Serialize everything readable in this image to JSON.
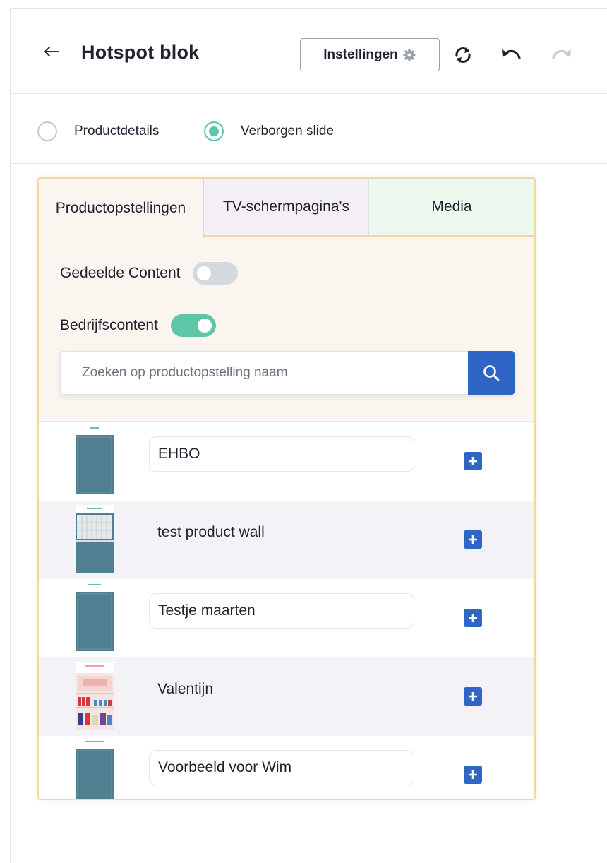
{
  "header": {
    "title": "Hotspot blok",
    "settings_label": "Instellingen"
  },
  "radios": [
    {
      "label": "Productdetails",
      "selected": false
    },
    {
      "label": "Verborgen slide",
      "selected": true
    }
  ],
  "tabs": [
    {
      "label": "Productopstellingen",
      "active": true
    },
    {
      "label": "TV-schermpagina's",
      "active": false
    },
    {
      "label": "Media",
      "active": false
    }
  ],
  "filters": {
    "shared_content_label": "Gedeelde Content",
    "shared_content_on": false,
    "company_content_label": "Bedrijfscontent",
    "company_content_on": true
  },
  "search": {
    "placeholder": "Zoeken op productopstelling naam"
  },
  "items": [
    {
      "name": "EHBO",
      "thumbnail": "empty-shelf"
    },
    {
      "name": "test product wall",
      "thumbnail": "product-wall"
    },
    {
      "name": "Testje maarten",
      "thumbnail": "empty-shelf"
    },
    {
      "name": "Valentijn",
      "thumbnail": "valentine-shelf"
    },
    {
      "name": "Voorbeeld voor Wim",
      "thumbnail": "empty-shelf"
    }
  ],
  "colors": {
    "accent_green": "#5ec6a7",
    "primary_blue": "#2f66c6",
    "panel_border": "#f1d89c"
  }
}
